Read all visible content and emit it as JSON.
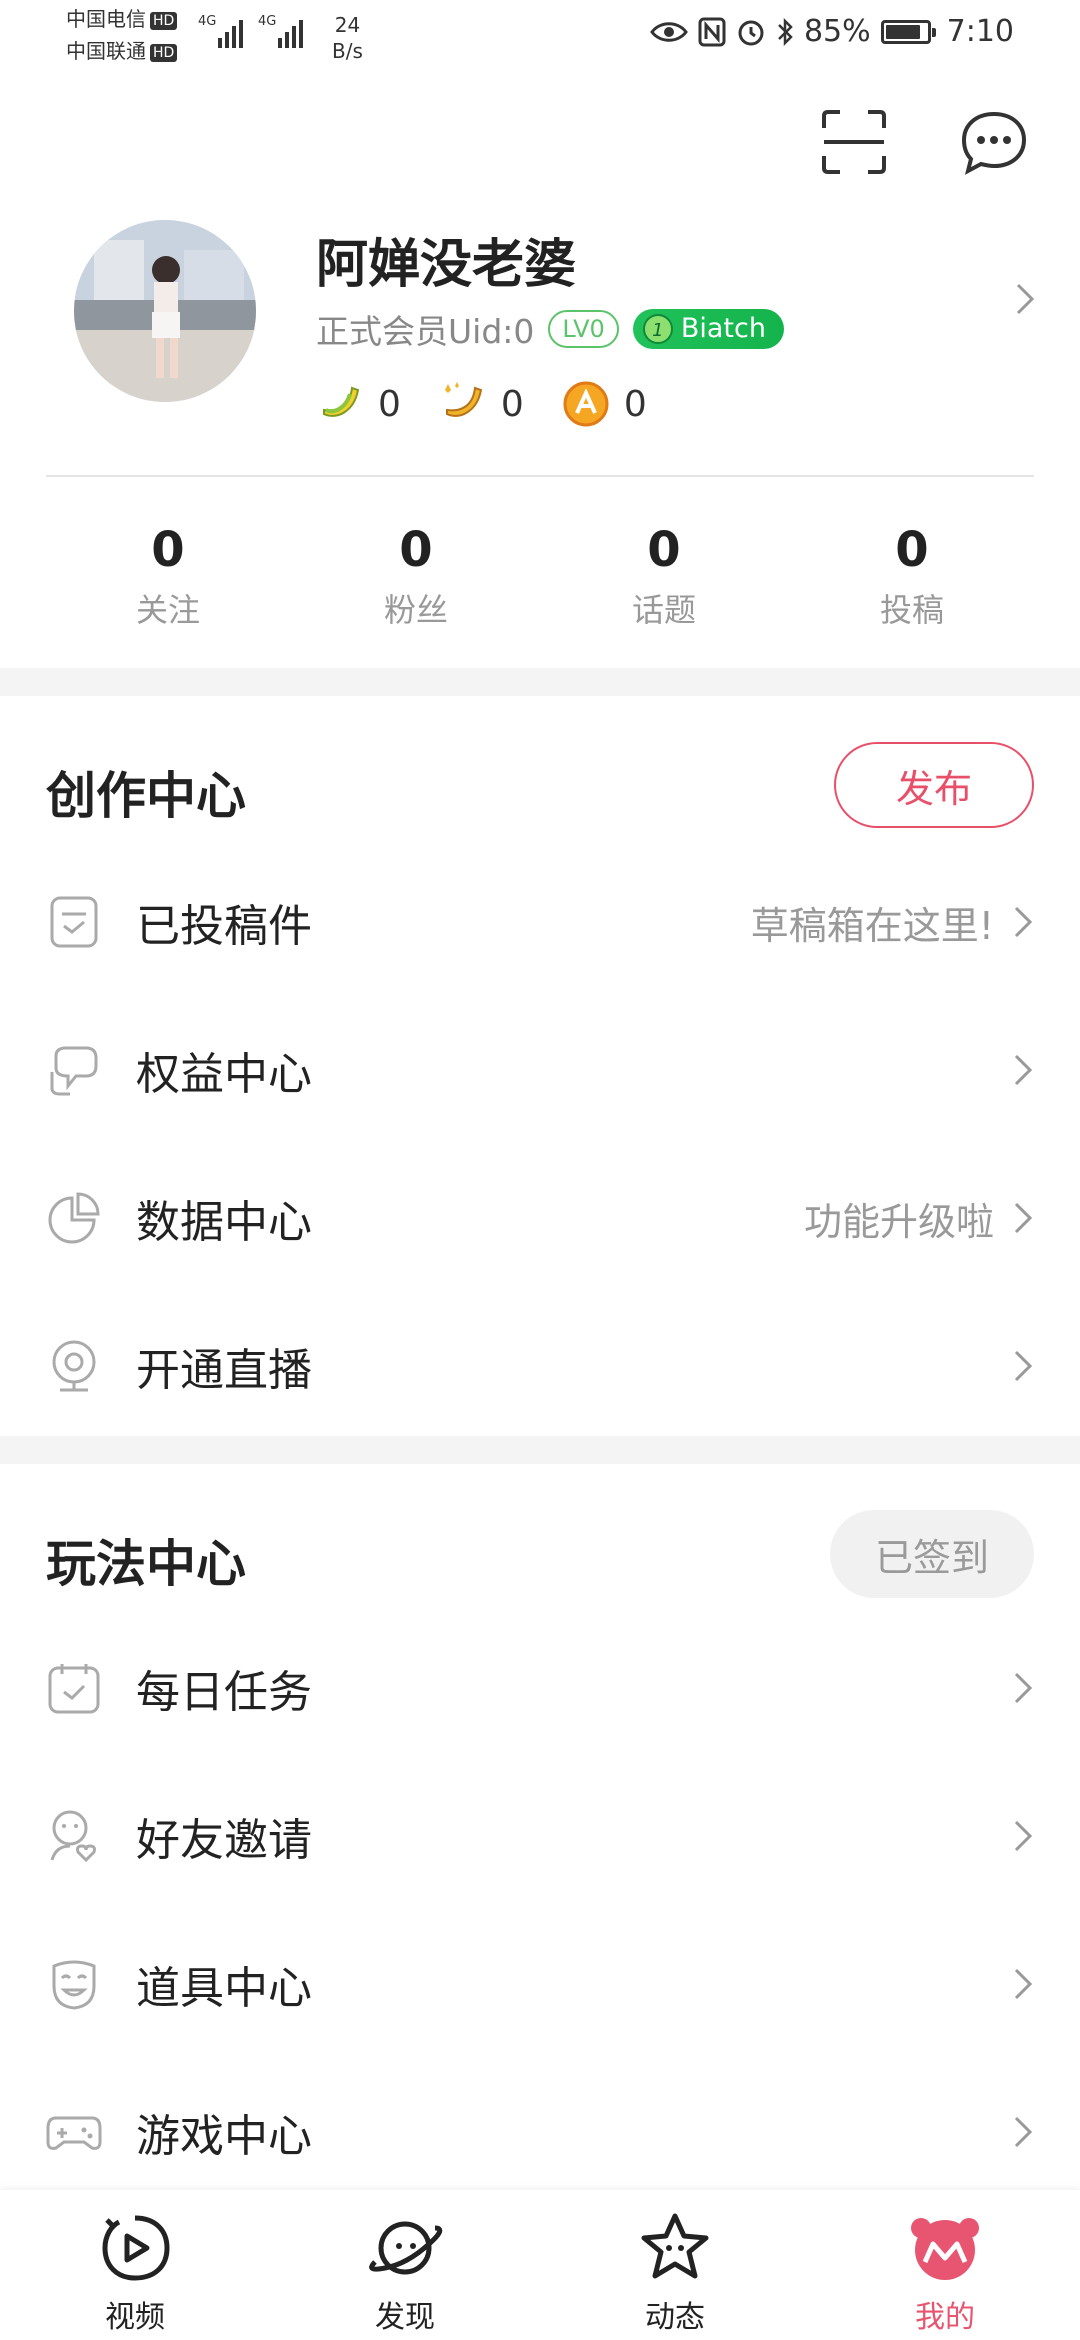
{
  "status_bar": {
    "carrier1": "中国电信",
    "carrier2": "中国联通",
    "hd": "HD",
    "net1": "4G",
    "net2": "4G",
    "speed_value": "24",
    "speed_unit": "B/s",
    "battery_percent": "85%",
    "battery_level": 0.85,
    "time": "7:10"
  },
  "profile": {
    "username": "阿婵没老婆",
    "member_text": "正式会员Uid:0",
    "level": "LV0",
    "medal_num": "1",
    "medal_name": "Biatch",
    "currencies": [
      {
        "icon": "banana-icon",
        "value": "0"
      },
      {
        "icon": "golden-banana-icon",
        "value": "0"
      },
      {
        "icon": "coin-icon",
        "value": "0"
      }
    ]
  },
  "stats": [
    {
      "value": "0",
      "label": "关注"
    },
    {
      "value": "0",
      "label": "粉丝"
    },
    {
      "value": "0",
      "label": "话题"
    },
    {
      "value": "0",
      "label": "投稿"
    }
  ],
  "creation": {
    "title": "创作中心",
    "publish_label": "发布",
    "items": [
      {
        "label": "已投稿件",
        "hint": "草稿箱在这里!",
        "icon": "document-icon"
      },
      {
        "label": "权益中心",
        "hint": "",
        "icon": "rights-icon"
      },
      {
        "label": "数据中心",
        "hint": "功能升级啦",
        "icon": "pie-chart-icon"
      },
      {
        "label": "开通直播",
        "hint": "",
        "icon": "webcam-icon"
      }
    ]
  },
  "play": {
    "title": "玩法中心",
    "signed_label": "已签到",
    "items": [
      {
        "label": "每日任务",
        "icon": "calendar-check-icon"
      },
      {
        "label": "好友邀请",
        "icon": "friend-invite-icon"
      },
      {
        "label": "道具中心",
        "icon": "mask-icon"
      },
      {
        "label": "游戏中心",
        "icon": "gamepad-icon"
      }
    ]
  },
  "bottom_nav": [
    {
      "label": "视频",
      "icon": "video-play-icon",
      "active": false
    },
    {
      "label": "发现",
      "icon": "planet-icon",
      "active": false
    },
    {
      "label": "动态",
      "icon": "star-face-icon",
      "active": false
    },
    {
      "label": "我的",
      "icon": "mine-icon",
      "active": true
    }
  ],
  "colors": {
    "accent": "#e8506a",
    "medal_green": "#1bbd55",
    "level_green": "#5bc46a",
    "muted_text": "#999999"
  }
}
